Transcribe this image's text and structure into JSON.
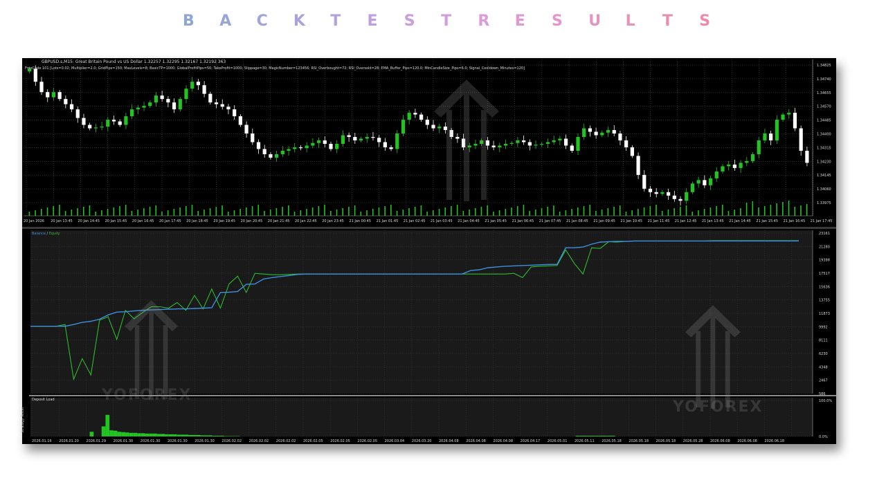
{
  "title": {
    "letters": [
      "B",
      "A",
      "C",
      "K",
      "T",
      "E",
      "S",
      "T",
      "R",
      "E",
      "S",
      "U",
      "L",
      "T",
      "S"
    ],
    "colors": [
      "#8fa6d4",
      "#97a5d8",
      "#a1a4da",
      "#aba2dc",
      "#b5a0dd",
      "#c09fde",
      "#ca9ddd",
      "#d49cdc",
      "#dc9ad8",
      "#e098d2",
      "#e396cb",
      "#e594c2",
      "#e692b9",
      "#e78faf",
      "#e98ca7"
    ]
  },
  "price_chart": {
    "header": "GBPUSD.s,M15:  Great Britain Pound vs US Dollar  1.32257 1.32295 1.32167 1.32192  363",
    "params": "FreeCode 101 [Lots=0.02; Multiplier=2.0; GridPips=150; MaxLevels=8; BasicTP=1000; GlobalProfitPips=50; TakeProfit=1000; Slippage=30; MagicNumber=123456; RSI_Overbought=72; RSI_Oversold=28; EMA_Buffer_Pips=120.0; MinCandleSize_Pips=6.0; Signal_Cooldown_Minutes=120]",
    "y_ticks": [
      "1.34825",
      "1.34740",
      "1.34655",
      "1.34570",
      "1.34485",
      "1.34400",
      "1.34315",
      "1.34230",
      "1.34145",
      "1.34060",
      "1.33975"
    ],
    "x_ticks": [
      "20 Jan 2026",
      "20 Jan 13:45",
      "20 Jan 14:45",
      "20 Jan 15:45",
      "20 Jan 16:45",
      "20 Jan 17:45",
      "20 Jan 18:45",
      "20 Jan 19:45",
      "20 Jan 20:45",
      "20 Jan 21:45",
      "20 Jan 22:45",
      "20 Jan 23:45",
      "21 Jan 00:45",
      "21 Jan 01:45",
      "21 Jan 02:45",
      "21 Jan 03:45",
      "21 Jan 04:45",
      "21 Jan 05:45",
      "21 Jan 06:45",
      "21 Jan 07:45",
      "21 Jan 08:45",
      "21 Jan 09:45",
      "21 Jan 10:45",
      "21 Jan 11:45",
      "21 Jan 12:45",
      "21 Jan 13:45",
      "21 Jan 14:45",
      "21 Jan 15:45",
      "21 Jan 16:45",
      "21 Jan 17:45"
    ],
    "bull_color": "#22c322",
    "bear_color": "#ffffff",
    "volume_color": "#22c322",
    "closes": [
      1.34795,
      1.3472,
      1.3466,
      1.3463,
      1.3466,
      1.3462,
      1.3459,
      1.3456,
      1.3451,
      1.3447,
      1.3445,
      1.34455,
      1.3446,
      1.345,
      1.3449,
      1.3447,
      1.3452,
      1.3456,
      1.3457,
      1.3458,
      1.346,
      1.3464,
      1.3462,
      1.346,
      1.3456,
      1.3462,
      1.3468,
      1.3472,
      1.347,
      1.3465,
      1.346,
      1.3459,
      1.34575,
      1.3456,
      1.3452,
      1.3447,
      1.3442,
      1.3437,
      1.3433,
      1.343,
      1.3428,
      1.343,
      1.3432,
      1.3433,
      1.3434,
      1.34335,
      1.3435,
      1.34365,
      1.3438,
      1.3436,
      1.3433,
      1.3436,
      1.3441,
      1.344,
      1.3438,
      1.3439,
      1.344,
      1.34395,
      1.3437,
      1.3434,
      1.3433,
      1.3442,
      1.345,
      1.3454,
      1.3453,
      1.345,
      1.3447,
      1.3445,
      1.3446,
      1.3444,
      1.344,
      1.3439,
      1.3434,
      1.3435,
      1.3436,
      1.3438,
      1.3435,
      1.3434,
      1.3435,
      1.3436,
      1.34365,
      1.3438,
      1.3437,
      1.3435,
      1.34355,
      1.3436,
      1.3437,
      1.3438,
      1.3439,
      1.3435,
      1.3432,
      1.344,
      1.3445,
      1.3443,
      1.3441,
      1.34425,
      1.3444,
      1.3442,
      1.3438,
      1.3434,
      1.3429,
      1.3418,
      1.341,
      1.3408,
      1.3407,
      1.3408,
      1.3406,
      1.3404,
      1.3403,
      1.3408,
      1.3413,
      1.3415,
      1.3412,
      1.3416,
      1.342,
      1.3423,
      1.3424,
      1.3422,
      1.3425,
      1.3426,
      1.343,
      1.3438,
      1.3442,
      1.3438,
      1.345,
      1.3453,
      1.3454,
      1.3445,
      1.3432,
      1.3425
    ]
  },
  "equity_chart": {
    "legend_balance": "Balance",
    "legend_sep": " / ",
    "legend_equity": "Equity",
    "balance_color": "#3d8fe0",
    "equity_color": "#2dbb2d",
    "close_label": "✕",
    "y_ticks": [
      "23161",
      "21280",
      "19398",
      "17517",
      "15636",
      "13755",
      "11873",
      "9992",
      "8111",
      "6230",
      "4348",
      "2467",
      "586"
    ],
    "ylim": [
      586,
      23161
    ],
    "balance": [
      10050,
      10050,
      10050,
      10050,
      10050,
      10300,
      10600,
      10750,
      11050,
      11650,
      12050,
      12100,
      12200,
      12300,
      12350,
      12400,
      12450,
      12500,
      12500,
      12550,
      12600,
      12650,
      14800,
      14850,
      14950,
      15950,
      16000,
      16700,
      16900,
      17050,
      17200,
      17350,
      17400,
      17400,
      17400,
      17400,
      17400,
      17400,
      17400,
      17400,
      17400,
      17400,
      17400,
      17400,
      17400,
      17400,
      17400,
      17400,
      17400,
      17400,
      17400,
      17900,
      18000,
      18300,
      18400,
      18500,
      18550,
      18600,
      18650,
      18700,
      18750,
      18750,
      21100,
      21100,
      21200,
      21600,
      21900,
      21950,
      22000,
      22000,
      22050,
      22050,
      22050,
      22050,
      22050,
      22050,
      22050,
      22050,
      22050,
      22050,
      22050,
      22050,
      22050,
      22050,
      22050,
      22050,
      22050,
      22050,
      22050,
      22050
    ],
    "equity": [
      10050,
      10050,
      10050,
      10050,
      10300,
      2600,
      5500,
      3200,
      10900,
      11400,
      8200,
      12300,
      11100,
      12000,
      12800,
      12800,
      12600,
      13400,
      12300,
      14400,
      12500,
      15300,
      12600,
      16000,
      17100,
      14800,
      17500,
      17400,
      17300,
      17300,
      17350,
      17400,
      17400,
      17400,
      17400,
      17400,
      17400,
      17400,
      17400,
      17400,
      17400,
      17400,
      17400,
      17400,
      17400,
      17400,
      17400,
      17400,
      17400,
      17400,
      17400,
      17400,
      17400,
      17400,
      17400,
      17400,
      17500,
      16900,
      18400,
      18500,
      18550,
      18600,
      20800,
      18900,
      17400,
      21100,
      21000,
      21950,
      21900,
      22000,
      22050,
      22050,
      22050,
      22050,
      22050,
      22050,
      22050,
      22050,
      22050,
      22100,
      22100,
      22100,
      22100,
      22100,
      22100,
      22100,
      22100,
      22100,
      22100,
      22100
    ]
  },
  "deposit_load": {
    "label": "Deposit Load",
    "y_ticks": [
      "100.0%",
      "0.0%"
    ],
    "bar_color": "#22c322",
    "values": [
      0,
      0,
      0,
      0,
      0,
      0,
      0,
      0,
      0,
      0,
      0,
      0,
      0,
      0,
      0,
      13,
      0,
      0,
      28,
      60,
      17,
      16,
      13,
      12,
      11,
      10,
      10,
      9,
      9,
      8,
      8,
      8,
      7,
      7,
      6,
      6,
      6,
      5,
      5,
      5,
      4,
      4,
      4,
      3,
      3,
      3,
      2,
      2,
      2,
      1,
      1,
      1,
      1,
      0,
      0,
      0,
      0,
      0,
      0,
      0,
      0,
      0,
      0,
      0,
      0,
      0,
      0,
      0,
      0,
      0,
      0,
      0,
      0,
      0,
      0,
      0,
      0,
      0,
      0,
      0,
      0,
      0,
      0,
      0,
      0,
      0,
      0,
      0,
      0,
      0,
      0,
      0,
      0,
      0,
      0,
      0,
      0,
      0,
      0,
      0,
      0,
      0,
      0,
      0,
      0,
      0,
      0,
      0,
      0,
      0,
      0,
      0,
      0,
      0,
      0,
      0,
      0,
      0,
      0,
      0,
      0,
      0,
      0,
      0,
      0,
      0,
      0,
      0,
      0,
      0,
      0,
      0,
      0,
      0,
      0,
      0,
      0,
      0,
      2,
      2,
      2,
      2,
      2,
      2,
      2,
      2,
      2,
      2,
      0,
      0,
      0,
      0,
      0,
      0,
      0,
      0,
      0,
      0,
      0,
      0,
      0,
      0,
      0,
      0,
      0,
      0,
      0,
      0,
      0,
      0,
      0,
      0,
      0,
      0,
      0,
      0,
      0,
      0,
      0,
      0,
      0,
      0,
      0,
      0,
      0,
      0,
      0,
      0,
      0,
      0,
      0,
      0,
      0,
      0,
      0,
      0,
      0,
      0
    ],
    "x_ticks": [
      "2026.01.16",
      "2026.01.20",
      "2026.01.29",
      "2026.01.30",
      "2026.01.30",
      "2026.01.30",
      "2026.01.30",
      "2026.02.02",
      "2026.02.02",
      "2026.02.02",
      "2026.02.05",
      "2026.02.05",
      "2026.02.05",
      "2026.03.04",
      "2026.03.20",
      "2026.04.08",
      "2026.04.08",
      "2026.04.08",
      "2026.04.17",
      "2026.05.01",
      "2026.05.11",
      "2026.05.18",
      "2026.05.18",
      "2026.05.18",
      "2026.05.28",
      "2026.06.08",
      "2026.06.08",
      "2026.06.18"
    ]
  },
  "side_panel_label": "Strategy Tester",
  "watermark": {
    "text": "YOFOREX"
  }
}
